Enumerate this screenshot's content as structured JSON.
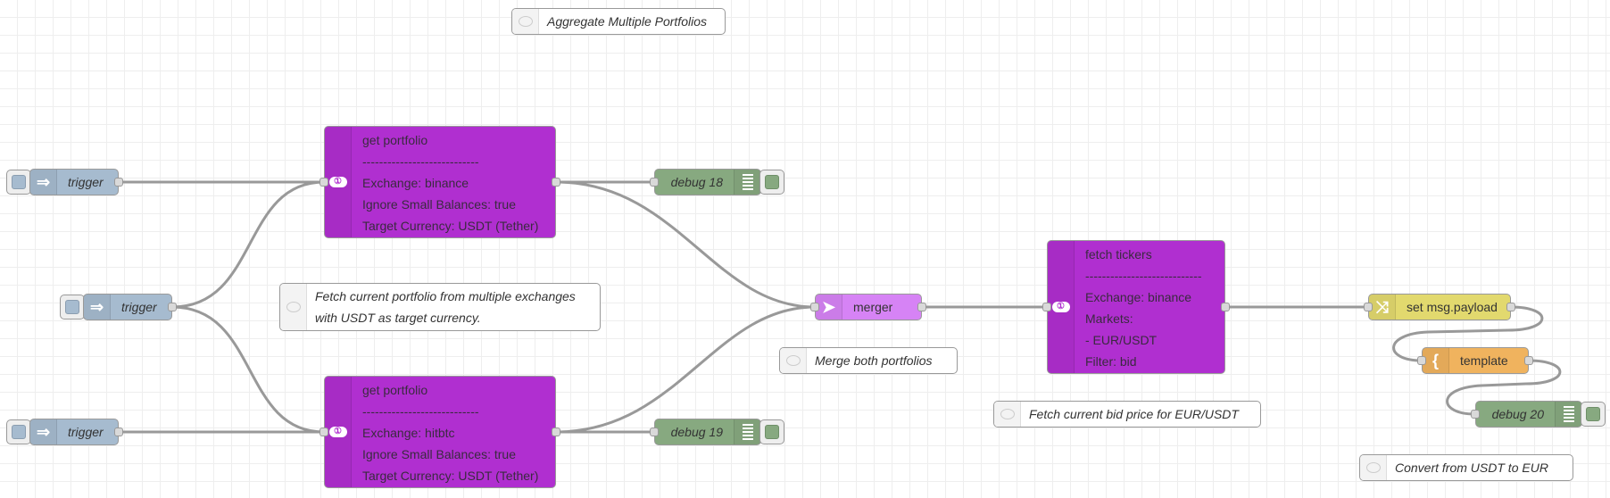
{
  "canvas": {
    "app": "Node-RED flow editor"
  },
  "colors": {
    "inject": "#a6bbcf",
    "debug": "#87a980",
    "ccxt": "#b02fd0",
    "merger": "#d683f5",
    "change": "#e2d96e",
    "template": "#f0b35e",
    "wire": "#999999"
  },
  "comments": {
    "title": {
      "icon": "comment-icon",
      "lines": [
        "Aggregate Multiple Portfolios"
      ]
    },
    "fetch_portfolio": {
      "icon": "comment-icon",
      "lines": [
        "Fetch current portfolio from multiple exchanges",
        "with USDT as target currency."
      ]
    },
    "merge": {
      "icon": "comment-icon",
      "lines": [
        "Merge both portfolios"
      ]
    },
    "fetch_bid": {
      "icon": "comment-icon",
      "lines": [
        "Fetch current bid price for EUR/USDT"
      ]
    },
    "convert": {
      "icon": "comment-icon",
      "lines": [
        "Convert from USDT to EUR"
      ]
    }
  },
  "nodes": {
    "trigger_1": {
      "type": "inject",
      "icon": "arrow-right-icon",
      "label": "trigger"
    },
    "trigger_2": {
      "type": "inject",
      "icon": "arrow-right-icon",
      "label": "trigger"
    },
    "trigger_3": {
      "type": "inject",
      "icon": "arrow-right-icon",
      "label": "trigger"
    },
    "portfolio_binance": {
      "type": "ccxt",
      "icon": "banknote-icon",
      "lines": [
        "get portfolio",
        "----------------------------",
        "Exchange: binance",
        "Ignore Small Balances: true",
        "Target Currency: USDT (Tether)"
      ]
    },
    "portfolio_hitbtc": {
      "type": "ccxt",
      "icon": "banknote-icon",
      "lines": [
        "get portfolio",
        "----------------------------",
        "Exchange: hitbtc",
        "Ignore Small Balances: true",
        "Target Currency: USDT (Tether)"
      ]
    },
    "debug_18": {
      "type": "debug",
      "icon": "list-icon",
      "label": "debug 18"
    },
    "debug_19": {
      "type": "debug",
      "icon": "list-icon",
      "label": "debug 19"
    },
    "merger": {
      "type": "merger",
      "icon": "arrow-right-icon",
      "label": "merger"
    },
    "fetch_tickers": {
      "type": "ccxt",
      "icon": "banknote-icon",
      "lines": [
        "fetch tickers",
        "----------------------------",
        "Exchange: binance",
        "Markets:",
        "- EUR/USDT",
        "Filter: bid"
      ]
    },
    "set_payload": {
      "type": "change",
      "icon": "shuffle-icon",
      "label": "set msg.payload"
    },
    "template": {
      "type": "template",
      "icon": "brace-icon",
      "label": "template"
    },
    "debug_20": {
      "type": "debug",
      "icon": "list-icon",
      "label": "debug 20"
    }
  }
}
